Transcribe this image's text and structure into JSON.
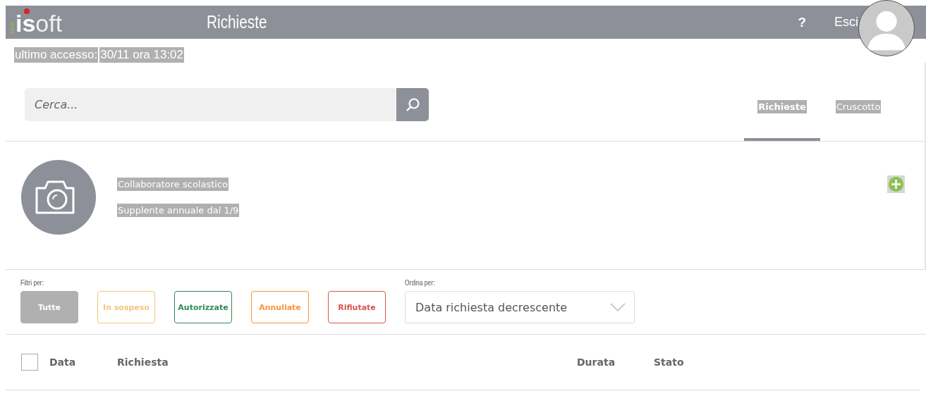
{
  "header": {
    "logo": {
      "tag": "new",
      "strong": "is",
      "light": "oft"
    },
    "title": "Richieste",
    "help": "?",
    "logout": "Esci"
  },
  "last_access": {
    "label": "ultimo accesso:",
    "value": "30/11 ora 13:02"
  },
  "search": {
    "placeholder": "Cerca..."
  },
  "tabs": [
    {
      "label": "Richieste",
      "selected": true
    },
    {
      "label": "Cruscotto",
      "selected": false
    }
  ],
  "profile": {
    "role": "Collaboratore scolastico",
    "contract": "Supplente annuale dal 1/9"
  },
  "filters": {
    "label": "Filtri per:",
    "items": [
      {
        "label": "Tutte",
        "selected": true,
        "color": "#b0b0b0"
      },
      {
        "label": "In sospeso",
        "selected": false,
        "color": "#f2c57c"
      },
      {
        "label": "Autorizzate",
        "selected": false,
        "color": "#2e8b57"
      },
      {
        "label": "Annullate",
        "selected": false,
        "color": "#f7943c"
      },
      {
        "label": "Rifiutate",
        "selected": false,
        "color": "#d9534f"
      }
    ]
  },
  "sort": {
    "label": "Ordina per:",
    "value": "Data richiesta decrescente"
  },
  "table": {
    "select_all_checked": false,
    "columns": [
      "Data",
      "Richiesta",
      "Durata",
      "Stato"
    ]
  }
}
